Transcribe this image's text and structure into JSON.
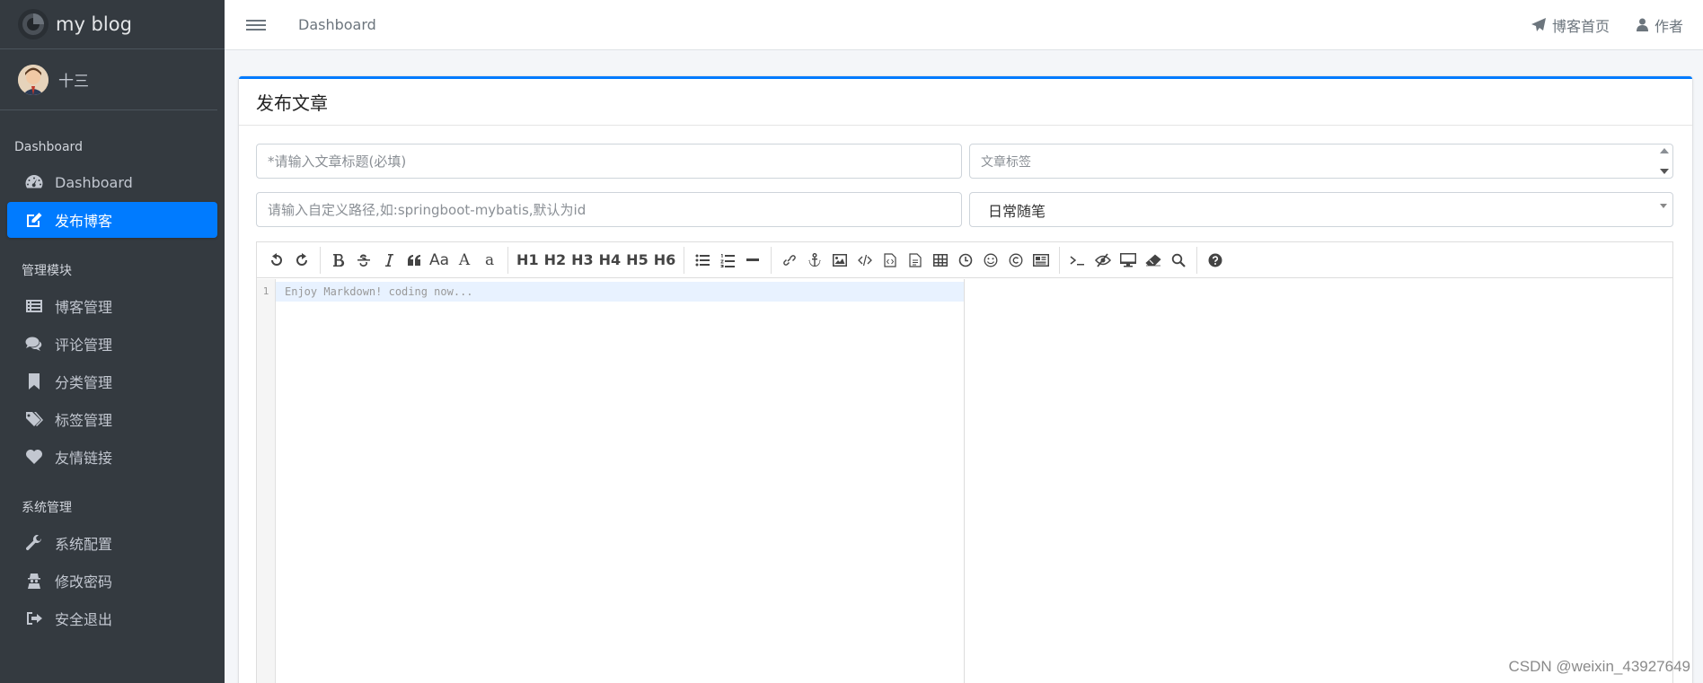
{
  "app": {
    "name": "my blog"
  },
  "user": {
    "name": "十三"
  },
  "sidebar": {
    "section1": "Dashboard",
    "items1": [
      {
        "label": "Dashboard",
        "icon": "dashboard-icon"
      },
      {
        "label": "发布博客",
        "icon": "edit-icon",
        "active": true
      }
    ],
    "section2": "管理模块",
    "items2": [
      {
        "label": "博客管理",
        "icon": "list-icon"
      },
      {
        "label": "评论管理",
        "icon": "comments-icon"
      },
      {
        "label": "分类管理",
        "icon": "bookmark-icon"
      },
      {
        "label": "标签管理",
        "icon": "tags-icon"
      },
      {
        "label": "友情链接",
        "icon": "heart-icon"
      }
    ],
    "section3": "系统管理",
    "items3": [
      {
        "label": "系统配置",
        "icon": "wrench-icon"
      },
      {
        "label": "修改密码",
        "icon": "user-secret-icon"
      },
      {
        "label": "安全退出",
        "icon": "sign-out-icon"
      }
    ]
  },
  "topbar": {
    "breadcrumb": "Dashboard",
    "links": [
      {
        "label": "博客首页",
        "icon": "paper-plane-icon"
      },
      {
        "label": "作者",
        "icon": "user-icon"
      }
    ]
  },
  "card": {
    "title": "发布文章",
    "title_placeholder": "*请输入文章标题(必填)",
    "tags_placeholder": "文章标签",
    "path_placeholder": "请输入自定义路径,如:springboot-mybatis,默认为id",
    "category_selected": "日常随笔"
  },
  "editor": {
    "toolbar_text": {
      "aa": "Aa",
      "a_upper": "A",
      "a_lower": "a",
      "h1": "H1",
      "h2": "H2",
      "h3": "H3",
      "h4": "H4",
      "h5": "H5",
      "h6": "H6"
    },
    "line_number": "1",
    "placeholder": "Enjoy Markdown! coding now..."
  },
  "watermark": "CSDN @weixin_43927649",
  "colors": {
    "sidebar_bg": "#343a40",
    "accent": "#007bff",
    "page_bg": "#f4f6f9"
  }
}
